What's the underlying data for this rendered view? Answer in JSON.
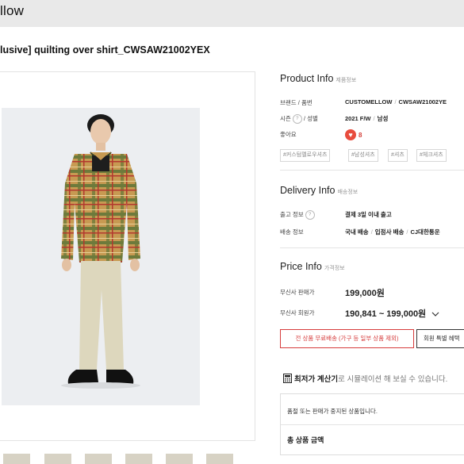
{
  "header": {
    "logo_text": "llow"
  },
  "product": {
    "title": "lusive] quilting over shirt_CWSAW21002YEX"
  },
  "product_info": {
    "title": "Product Info",
    "title_sub": "제품정보",
    "brand_label": "브랜드",
    "brand_sep": "/",
    "code_label": "품번",
    "brand_value": "CUSTOMELLOW",
    "code_value": "CWSAW21002YE",
    "season_label": "시즌",
    "gender_label": "성별",
    "season_value": "2021 F/W",
    "gender_value": "남성",
    "like_label": "좋아요",
    "like_count": "8",
    "tags": [
      "#커스텀멜로우셔츠",
      "#남성셔츠",
      "#셔츠",
      "#체크셔츠"
    ]
  },
  "delivery_info": {
    "title": "Delivery Info",
    "title_sub": "배송정보",
    "ship_label": "출고 정보",
    "ship_value": "결제 3일 이내 출고",
    "method_label": "배송 정보",
    "method_1": "국내 배송",
    "method_2": "입점사 배송",
    "method_3": "CJ대한통운"
  },
  "price_info": {
    "title": "Price Info",
    "title_sub": "가격정보",
    "sale_label": "무신사 판매가",
    "sale_value": "199,000원",
    "member_label": "무신사 회원가",
    "member_value": "190,841 ~ 199,000원",
    "free_ship_button": "전 상품 무료배송 (가구 등 일부 상품 제외)",
    "member_button": "회원 특별 혜택"
  },
  "calculator": {
    "title": "최저가 계산기",
    "text": "로 시뮬레이션 해 보실 수 있습니다."
  },
  "order_box": {
    "notice": "품절 또는 판매가 중지된 상품입니다.",
    "total_label": "총 상품 금액"
  },
  "icons": {
    "help": "question-circle-icon",
    "like": "heart-icon",
    "dropdown": "chevron-down-icon",
    "calculator": "calculator-icon"
  },
  "colors": {
    "accent_red": "#d63b3b",
    "heart_red": "#e84c3d",
    "header_bg": "#e9e9e9"
  }
}
